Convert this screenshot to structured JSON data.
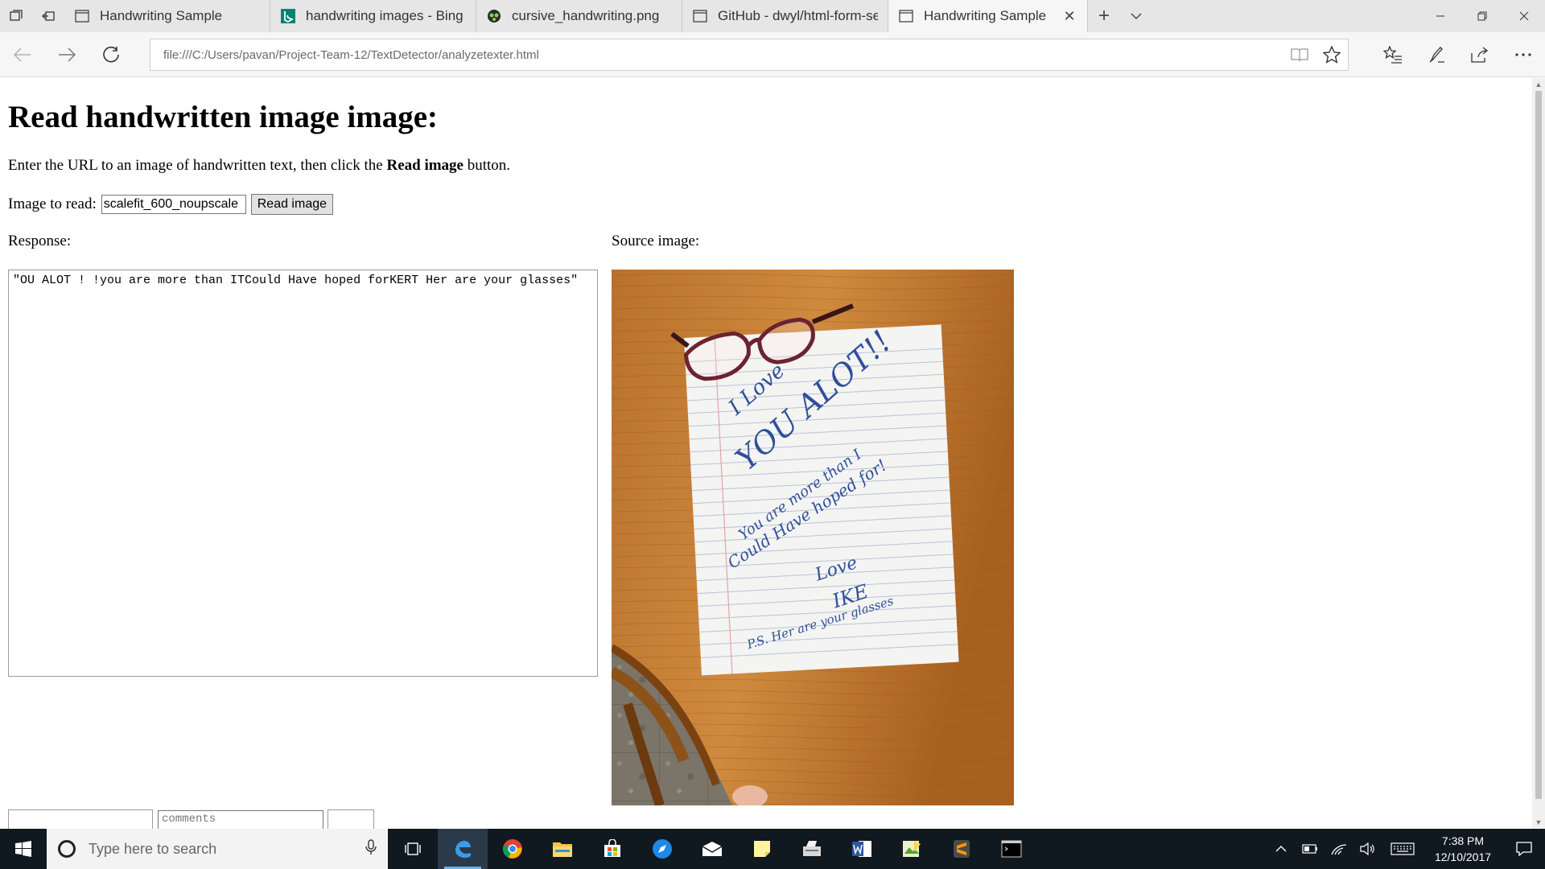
{
  "browser": {
    "tabs": [
      {
        "title": "Handwriting Sample",
        "icon": "page-icon",
        "active": false
      },
      {
        "title": "handwriting images - Bing i",
        "icon": "bing-icon",
        "active": false
      },
      {
        "title": "cursive_handwriting.png",
        "icon": "image-tab-icon",
        "active": false
      },
      {
        "title": "GitHub - dwyl/html-form-se",
        "icon": "page-icon",
        "active": false
      },
      {
        "title": "Handwriting Sample",
        "icon": "page-icon",
        "active": true
      }
    ],
    "address": "file:///C:/Users/pavan/Project-Team-12/TextDetector/analyzetexter.html",
    "tab_close_glyph": "✕"
  },
  "page": {
    "title": "Read handwritten image image:",
    "intro_before": "Enter the URL to an image of handwritten text, then click the ",
    "intro_bold": "Read image",
    "intro_after": " button.",
    "input_label": "Image to read:",
    "input_value": "scalefit_600_noupscale",
    "read_button": "Read image",
    "response_label": "Response:",
    "source_label": "Source image:",
    "response_text": "\"OU ALOT ! !you are more than ITCould Have hoped forKERT Her are your glasses\"",
    "comments_placeholder": "comments",
    "note_lines": [
      "I Love",
      "YOU ALOT!!",
      "You are more than I",
      "Could Have hoped for!",
      "Love",
      "IKE",
      "P.S. Her are your glasses"
    ]
  },
  "taskbar": {
    "search_placeholder": "Type here to search",
    "time": "7:38 PM",
    "date": "12/10/2017"
  }
}
